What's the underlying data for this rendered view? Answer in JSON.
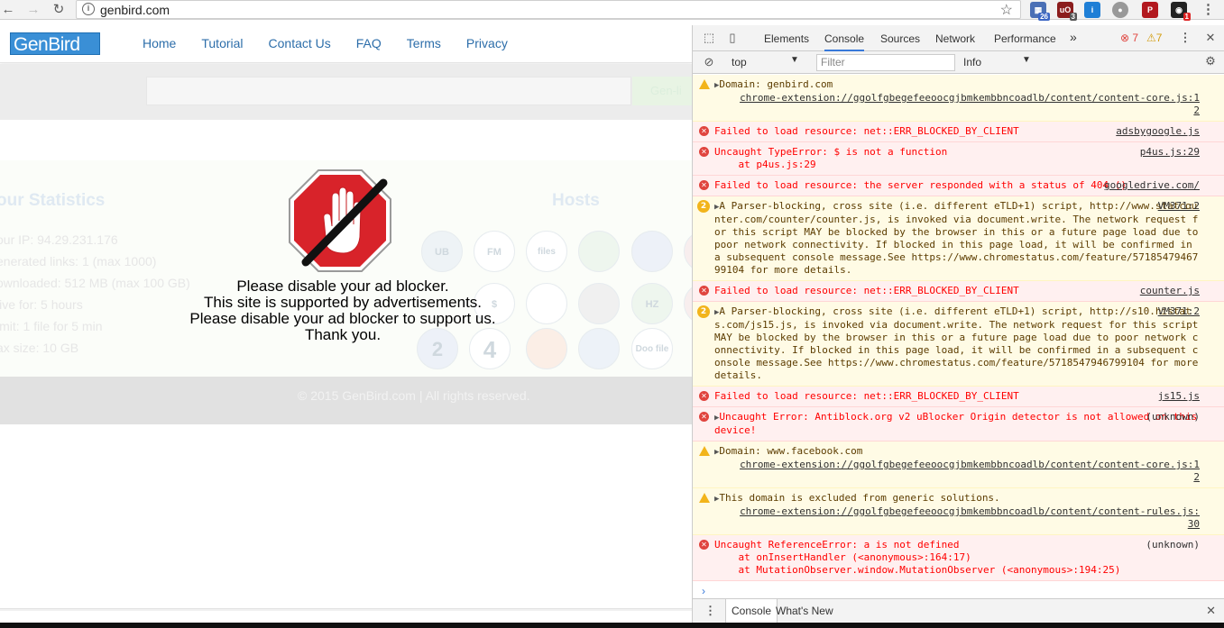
{
  "browser": {
    "url": "genbird.com",
    "ext_badges": [
      "26",
      "3",
      "1"
    ]
  },
  "site": {
    "logo": "GenBird",
    "nav": [
      "Home",
      "Tutorial",
      "Contact Us",
      "FAQ",
      "Terms",
      "Privacy"
    ],
    "search_button": "Gen-li",
    "stats_title": "our Statistics",
    "hosts_title": "Hosts",
    "stats": [
      "our IP: 94.29.231.176",
      "enerated links: 1 (max 1000)",
      "ownloaded: 512 MB (max 100 GB)",
      "live for: 5 hours",
      "imit: 1 file for 5 min",
      "ax size: 10 GB"
    ],
    "hosts": [
      "UB",
      "FM",
      "files FLASH",
      "",
      "",
      "",
      "$",
      "",
      "",
      "HZ",
      "",
      "2",
      "4",
      "",
      "",
      "",
      "Doo file"
    ],
    "footer": "© 2015 GenBird.com | All rights reserved.",
    "blocker_lines": [
      "Please disable your ad blocker.",
      "This site is supported by advertisements.",
      "Please disable your ad blocker to support us.",
      "Thank you."
    ]
  },
  "devtools": {
    "tabs": [
      "Elements",
      "Console",
      "Sources",
      "Network",
      "Performance"
    ],
    "more_tabs": "»",
    "error_count": "7",
    "warn_count": "7",
    "context": "top",
    "filter_placeholder": "Filter",
    "level": "Info",
    "messages": [
      {
        "type": "warn",
        "text": "Domain: genbird.com",
        "expand": true,
        "src_block": "chrome-extension://ggolfgbegefeeoocgjbmkembbncoadlb/content/content-core.js:1\n2"
      },
      {
        "type": "error",
        "text": "Failed to load resource: net::ERR_BLOCKED_BY_CLIENT",
        "src": "adsbygoogle.js"
      },
      {
        "type": "error",
        "text": "Uncaught TypeError: $ is not a function\n    at p4us.js:29",
        "src": "p4us.js:29"
      },
      {
        "type": "error",
        "text": "Failed to load resource: the server responded with a status of 404 ()",
        "src": "googledrive.com/"
      },
      {
        "type": "warn",
        "repeat": "2",
        "expand": true,
        "text": "A Parser-blocking, cross site (i.e. different eTLD+1) script, http://www.statcounter.com/counter/counter.js, is invoked via document.write. The network request for this script MAY be blocked by the browser in this or a future page load due to poor network connectivity. If blocked in this page load, it will be confirmed in a subsequent console message.See https://www.chromestatus.com/feature/5718547946799104 for more details.",
        "src": "VM371:2"
      },
      {
        "type": "error",
        "text": "Failed to load resource: net::ERR_BLOCKED_BY_CLIENT",
        "src": "counter.js"
      },
      {
        "type": "warn",
        "repeat": "2",
        "expand": true,
        "text": "A Parser-blocking, cross site (i.e. different eTLD+1) script, http://s10.histats.com/js15.js, is invoked via document.write. The network request for this script MAY be blocked by the browser in this or a future page load due to poor network connectivity. If blocked in this page load, it will be confirmed in a subsequent console message.See https://www.chromestatus.com/feature/5718547946799104 for more details.",
        "src": "VM371:2"
      },
      {
        "type": "error",
        "text": "Failed to load resource: net::ERR_BLOCKED_BY_CLIENT",
        "src": "js15.js"
      },
      {
        "type": "error",
        "expand": true,
        "text": "Uncaught Error: Antiblock.org v2 uBlocker Origin detector is not allowed on this device!",
        "src_plain": "(unknown)"
      },
      {
        "type": "warn",
        "expand": true,
        "text": "Domain: www.facebook.com",
        "src_block": "chrome-extension://ggolfgbegefeeoocgjbmkembbncoadlb/content/content-core.js:1\n2"
      },
      {
        "type": "warn",
        "expand": true,
        "text": "This domain is excluded from generic solutions.",
        "src_block": "chrome-extension://ggolfgbegefeeoocgjbmkembbncoadlb/content/content-rules.js:\n30"
      },
      {
        "type": "error",
        "text": "Uncaught ReferenceError: a is not defined\n    at onInsertHandler (<anonymous>:164:17)\n    at MutationObserver.window.MutationObserver (<anonymous>:194:25)",
        "src_plain": "(unknown)"
      }
    ],
    "drawer_tabs": [
      "Console",
      "What's New"
    ]
  }
}
